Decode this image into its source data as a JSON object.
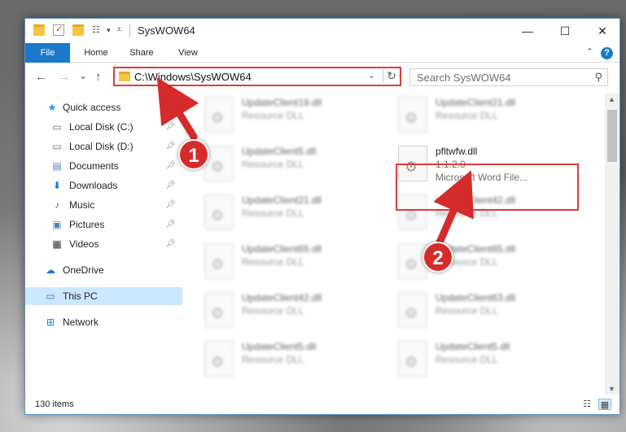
{
  "window": {
    "title": "SysWOW64",
    "minimize": "—",
    "maximize": "☐",
    "close": "✕"
  },
  "ribbon": {
    "tabs": [
      "File",
      "Home",
      "Share",
      "View"
    ],
    "help": "?",
    "collapse": "⌃"
  },
  "address": {
    "path": "C:\\Windows\\SysWOW64",
    "search_placeholder": "Search SysWOW64"
  },
  "nav": {
    "back": "←",
    "forward": "→",
    "recent": "⌄",
    "up": "↑"
  },
  "sidebar": {
    "items": [
      {
        "label": "Quick access",
        "icon": "star-icon",
        "pinned": false
      },
      {
        "label": "Local Disk (C:)",
        "icon": "drive-icon",
        "pinned": true
      },
      {
        "label": "Local Disk (D:)",
        "icon": "drive-icon",
        "pinned": true
      },
      {
        "label": "Documents",
        "icon": "document-icon",
        "pinned": true
      },
      {
        "label": "Downloads",
        "icon": "download-icon",
        "pinned": true
      },
      {
        "label": "Music",
        "icon": "music-icon",
        "pinned": true
      },
      {
        "label": "Pictures",
        "icon": "picture-icon",
        "pinned": true
      },
      {
        "label": "Videos",
        "icon": "video-icon",
        "pinned": true
      },
      {
        "label": "OneDrive",
        "icon": "cloud-icon",
        "pinned": false
      },
      {
        "label": "This PC",
        "icon": "computer-icon",
        "pinned": false
      },
      {
        "label": "Network",
        "icon": "network-icon",
        "pinned": false
      }
    ]
  },
  "files": {
    "left": [
      {
        "name": "UpdateClient19.dll",
        "type": "Resource DLL"
      },
      {
        "name": "UpdateClient5.dll",
        "type": "Resource DLL"
      },
      {
        "name": "UpdateClient21.dll",
        "type": "Resource DLL"
      },
      {
        "name": "UpdateClient65.dll",
        "type": "Resource DLL"
      },
      {
        "name": "UpdateClient42.dll",
        "type": "Resource DLL"
      },
      {
        "name": "UpdateClient5.dll",
        "type": "Resource DLL"
      }
    ],
    "right": [
      {
        "name": "UpdateClient21.dll",
        "type": "Resource DLL"
      },
      {
        "name": "pfltwfw.dll",
        "version": "1.1.2.0",
        "type": "Microsoft Word File..."
      },
      {
        "name": "UpdateClient42.dll",
        "type": "Resource DLL"
      },
      {
        "name": "UpdateClient65.dll",
        "type": "Resource DLL"
      },
      {
        "name": "UpdateClient63.dll",
        "type": "Resource DLL"
      },
      {
        "name": "UpdateClient5.dll",
        "type": "Resource DLL"
      }
    ]
  },
  "status": {
    "count": "130 items"
  },
  "annotations": {
    "step1": "1",
    "step2": "2",
    "color": "#d62b2b"
  }
}
